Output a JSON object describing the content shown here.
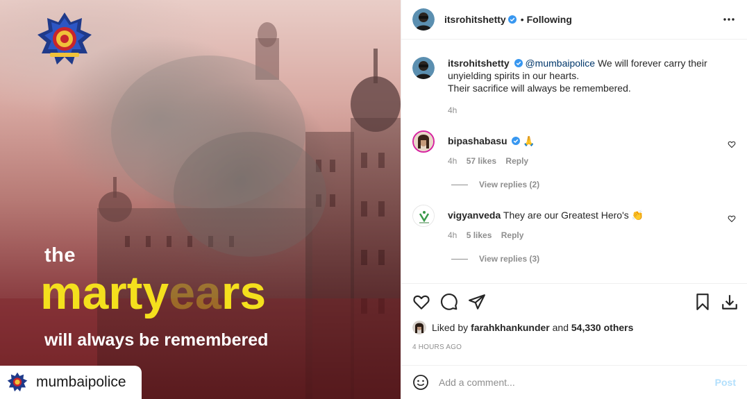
{
  "image": {
    "hero_the": "the",
    "hero_word_bright": "marty",
    "hero_word_dim": "ea",
    "hero_word_end": "rs",
    "hero_sub": "will always be remembered",
    "brand_tag": "mumbaipolice",
    "accent_yellow": "#f4e01d"
  },
  "header": {
    "username": "itsrohitshetty",
    "separator": "•",
    "follow_status": "Following",
    "more_icon": "more-horizontal-icon"
  },
  "caption": {
    "username": "itsrohitshetty",
    "mention": "@mumbaipolice",
    "line1": " We will forever carry their unyielding spirits in our hearts.",
    "line2": "Their sacrifice will always be remembered.",
    "time": "4h"
  },
  "comments": [
    {
      "username": "bipashabasu",
      "text": "🙏",
      "time": "4h",
      "likes": "57 likes",
      "reply": "Reply",
      "view_replies": "View replies (2)"
    },
    {
      "username": "vigyanveda",
      "text": "They are our Greatest Hero's 👏",
      "time": "4h",
      "likes": "5 likes",
      "reply": "Reply",
      "view_replies": "View replies (3)"
    }
  ],
  "likes": {
    "prefix": "Liked by ",
    "user": "farahkhankunder",
    "middle": " and ",
    "count": "54,330 others"
  },
  "timestamp": "4 HOURS AGO",
  "add_comment": {
    "placeholder": "Add a comment...",
    "post_label": "Post"
  },
  "colors": {
    "verified_blue": "#3897f0",
    "link_blue": "#00376b",
    "post_disabled": "#b2dffc",
    "secondary_text": "#8e8e8e"
  }
}
